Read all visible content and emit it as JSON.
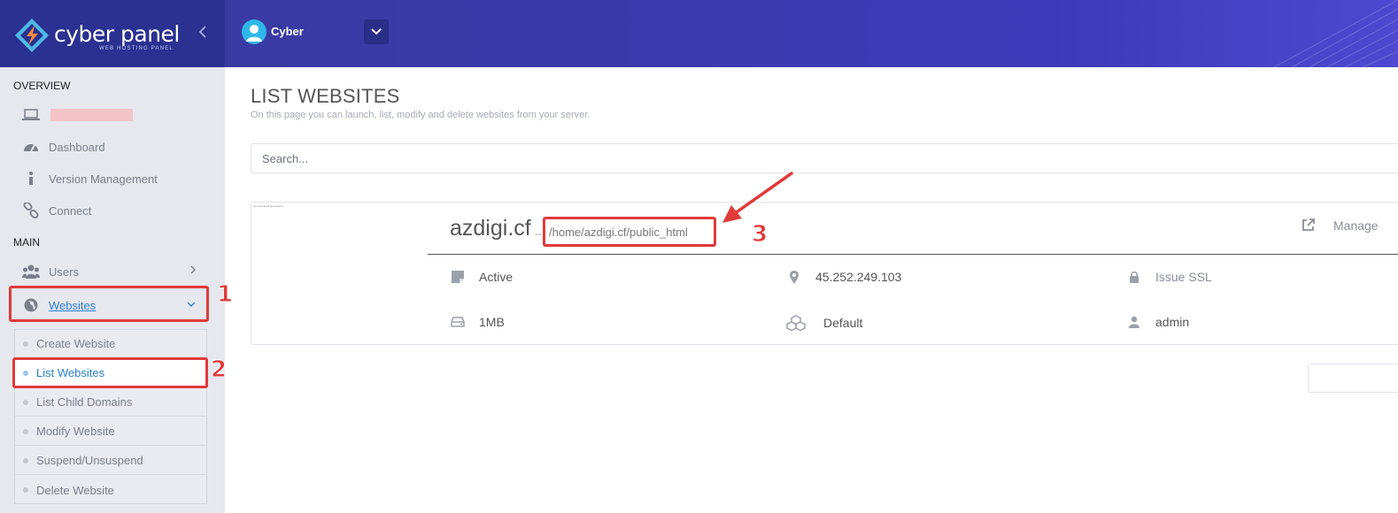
{
  "brand": {
    "name": "cyber panel",
    "tagline": "WEB HOSTING PANEL"
  },
  "topbar": {
    "user_name": "Cyber"
  },
  "sidebar": {
    "overview_heading": "OVERVIEW",
    "overview_items": [
      {
        "label": "Dashboard",
        "icon": "dashboard-icon"
      },
      {
        "label": "Version Management",
        "icon": "info-icon"
      },
      {
        "label": "Connect",
        "icon": "link-icon"
      }
    ],
    "main_heading": "MAIN",
    "users_label": "Users",
    "websites_label": "Websites",
    "websites_submenu": [
      "Create Website",
      "List Websites",
      "List Child Domains",
      "Modify Website",
      "Suspend/Unsuspend",
      "Delete Website"
    ]
  },
  "main": {
    "title": "LIST WEBSITES",
    "description": "On this page you can launch, list, modify and delete websites from your server.",
    "search_placeholder": "Search...",
    "site": {
      "thumbnail_note": "(no thumbnail generated)",
      "domain": "azdigi.cf",
      "path_separator": "--",
      "path": "/home/azdigi.cf/public_html",
      "manage_label": "Manage",
      "status": "Active",
      "ip": "45.252.249.103",
      "ssl_label": "Issue SSL",
      "disk_usage": "1MB",
      "package": "Default",
      "owner": "admin"
    }
  },
  "annotations": {
    "step1": "1",
    "step2": "2",
    "step3": "3"
  },
  "colors": {
    "highlight": "#e03a3a",
    "brand_bg": "#2b3191",
    "link": "#2a7fd4"
  }
}
